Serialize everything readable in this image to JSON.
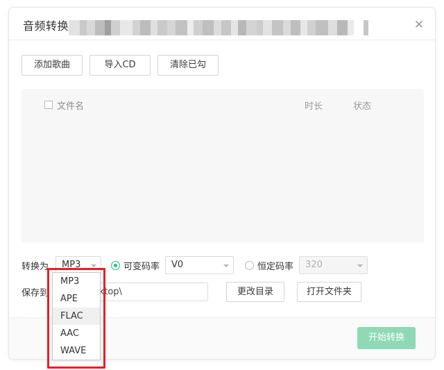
{
  "window": {
    "title": "音频转换",
    "close_icon": "close-icon",
    "redaction_blocks": [
      {
        "w": 16,
        "c": "#e3e3e3"
      },
      {
        "w": 10,
        "c": "#c9c9c9"
      },
      {
        "w": 12,
        "c": "#d8d8d8"
      },
      {
        "w": 14,
        "c": "#bdbdbd"
      },
      {
        "w": 9,
        "c": "#9e9e9e"
      },
      {
        "w": 13,
        "c": "#cfcfcf"
      },
      {
        "w": 18,
        "c": "#e8e8e8"
      },
      {
        "w": 11,
        "c": "#d2d2d2"
      },
      {
        "w": 15,
        "c": "#bcbcbc"
      },
      {
        "w": 10,
        "c": "#e0e0e0"
      },
      {
        "w": 14,
        "c": "#cacaca"
      },
      {
        "w": 12,
        "c": "#d6d6d6"
      },
      {
        "w": 17,
        "c": "#c2c2c2"
      },
      {
        "w": 9,
        "c": "#ededed"
      },
      {
        "w": 13,
        "c": "#d0d0d0"
      },
      {
        "w": 16,
        "c": "#bfbfbf"
      },
      {
        "w": 11,
        "c": "#dcdcdc"
      },
      {
        "w": 14,
        "c": "#c6c6c6"
      },
      {
        "w": 10,
        "c": "#e5e5e5"
      },
      {
        "w": 12,
        "c": "#b8b8b8"
      },
      {
        "w": 15,
        "c": "#d4d4d4"
      },
      {
        "w": 9,
        "c": "#cdcdcd"
      },
      {
        "w": 13,
        "c": "#e2e2e2"
      },
      {
        "w": 16,
        "c": "#c4c4c4"
      },
      {
        "w": 11,
        "c": "#dadada"
      },
      {
        "w": 14,
        "c": "#bebebe"
      },
      {
        "w": 10,
        "c": "#e7e7e7"
      },
      {
        "w": 12,
        "c": "#d1d1d1"
      },
      {
        "w": 18,
        "c": "#c0c0c0"
      },
      {
        "w": 13,
        "c": "#dedede"
      },
      {
        "w": 15,
        "c": "#b9b9b9"
      },
      {
        "w": 9,
        "c": "#eaeaea"
      },
      {
        "w": 14,
        "c": "#ccccccc"
      },
      {
        "w": 12,
        "c": "#c7c7c7"
      },
      {
        "w": 16,
        "c": "#e1e1e1"
      },
      {
        "w": 10,
        "c": "#bbbbbb"
      }
    ]
  },
  "toolbar": {
    "add_songs": "添加歌曲",
    "import_cd": "导入CD",
    "clear_checked": "清除已勾"
  },
  "filelist": {
    "col_filename": "文件名",
    "col_duration": "时长",
    "col_status": "状态",
    "rows": []
  },
  "settings": {
    "convert_to_label": "转换为",
    "format_value": "MP3",
    "format_options": [
      "MP3",
      "APE",
      "FLAC",
      "AAC",
      "WAVE"
    ],
    "format_hovered": "FLAC",
    "vbr_label": "可变码率",
    "vbr_selected": true,
    "vbr_value": "V0",
    "cbr_label": "恒定码率",
    "cbr_selected": false,
    "cbr_value": "320"
  },
  "save": {
    "save_to_label": "保存到",
    "path_value": "min\\Desktop\\",
    "change_dir": "更改目录",
    "open_folder": "打开文件夹"
  },
  "footer": {
    "start_label": "开始转换",
    "start_color": "#8fd9b6"
  },
  "annotation": {
    "box_color": "#ee1c25"
  }
}
